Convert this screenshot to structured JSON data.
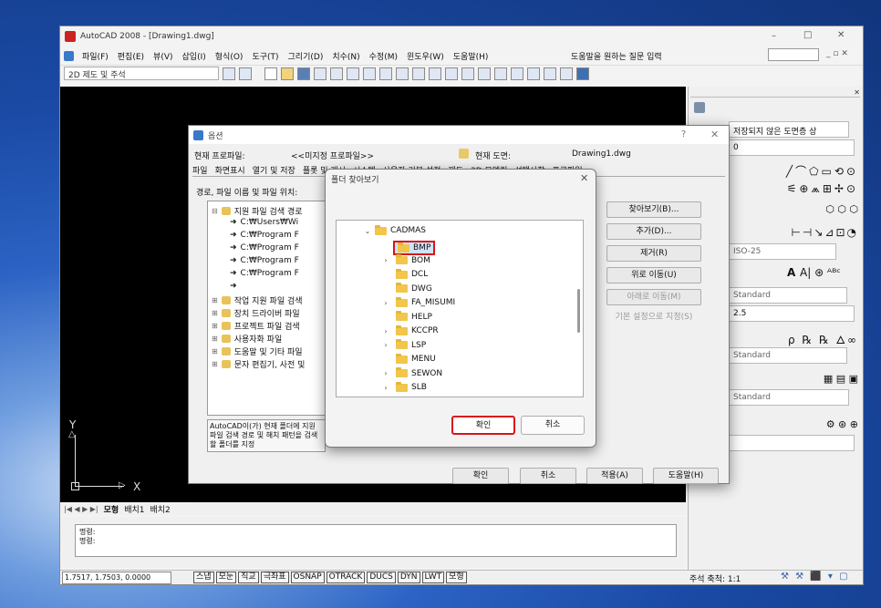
{
  "window": {
    "title": "AutoCAD 2008 - [Drawing1.dwg]",
    "minimize": "–",
    "maximize": "□",
    "close": "✕"
  },
  "menubar": {
    "items": [
      "파일(F)",
      "편집(E)",
      "뷰(V)",
      "삽입(I)",
      "형식(O)",
      "도구(T)",
      "그리기(D)",
      "치수(N)",
      "수정(M)",
      "윈도우(W)",
      "도움말(H)"
    ],
    "help_prompt": "도움말을 원하는 질문 입력"
  },
  "toolbar": {
    "workspace": "2D 제도 및 주석"
  },
  "palette": {
    "layer_combo": "저장되지 않은 도면층 상",
    "layer_value": "0",
    "dim_style": "ISO-25",
    "text_label": "A",
    "text_style": "Standard",
    "scale_value": "2.5",
    "multileader_style": "Standard",
    "table_style": "Standard"
  },
  "options_dialog": {
    "title": "옵션",
    "close": "✕",
    "help": "?",
    "profile_label": "현재 프로파일:",
    "profile_value": "<<미지정 프로파일>>",
    "drawing_label": "현재 도면:",
    "drawing_value": "Drawing1.dwg",
    "tabs": [
      "파일",
      "화면표시",
      "열기 및 저장",
      "플롯 및 게시",
      "시스템",
      "사용자 기본 설정",
      "제도",
      "3D 모델링",
      "선택사항",
      "프로파일"
    ],
    "section_label": "경로, 파일 이름 및 파일 위치:",
    "tree": [
      {
        "label": "지원 파일 검색 경로",
        "type": "expanded"
      },
      {
        "label": "C:₩Users₩Wi",
        "type": "path"
      },
      {
        "label": "C:₩Program F",
        "type": "path"
      },
      {
        "label": "C:₩Program F",
        "type": "path"
      },
      {
        "label": "C:₩Program F",
        "type": "path"
      },
      {
        "label": "C:₩Program F",
        "type": "path"
      },
      {
        "label": "",
        "type": "path"
      },
      {
        "label": "작업 지원 파일 검색",
        "type": "collapsed"
      },
      {
        "label": "장치 드라이버 파일",
        "type": "collapsed"
      },
      {
        "label": "프로젝트 파일 검색",
        "type": "collapsed"
      },
      {
        "label": "사용자화 파일",
        "type": "collapsed"
      },
      {
        "label": "도움말 및 기타 파일",
        "type": "collapsed"
      },
      {
        "label": "문자 편집기, 사전 및",
        "type": "collapsed"
      }
    ],
    "buttons": {
      "browse": "찾아보기(B)...",
      "add": "추가(D)...",
      "remove": "제거(R)",
      "move_up": "위로 이동(U)",
      "move_down": "아래로 이동(M)",
      "set_current": "기본 설정으로 지정(S)"
    },
    "description": "AutoCAD이(가) 현재 폴더에 지원 파일 검색 경로 및 해치 패턴을 검색할 폴더를 지정",
    "ok": "확인",
    "cancel": "취소",
    "apply": "적용(A)",
    "help_btn": "도움말(H)"
  },
  "folder_dialog": {
    "title": "폴더 찾아보기",
    "close": "✕",
    "parent": "CADMAS",
    "folders": [
      "BMP",
      "BOM",
      "DCL",
      "DWG",
      "FA_MISUMI",
      "HELP",
      "KCCPR",
      "LSP",
      "MENU",
      "SEWON",
      "SLB"
    ],
    "selected": "BMP",
    "ok": "확인",
    "cancel": "취소"
  },
  "layout_tabs": [
    "모형",
    "배치1",
    "배치2"
  ],
  "command": {
    "lines": [
      "명령:",
      "명령:"
    ]
  },
  "ucs": {
    "y": "Y",
    "x": "X"
  },
  "statusbar": {
    "coords": "1.7517, 1.7503, 0.0000",
    "toggles": [
      "스냅",
      "모눈",
      "직교",
      "극좌표",
      "OSNAP",
      "OTRACK",
      "DUCS",
      "DYN",
      "LWT",
      "모형"
    ],
    "annotation_scale": "주석 축척: 1:1"
  },
  "colors": {
    "selection_red": "#d9141c",
    "folder_yellow": "#f2c54b",
    "accent_blue": "#0b5cc2"
  }
}
